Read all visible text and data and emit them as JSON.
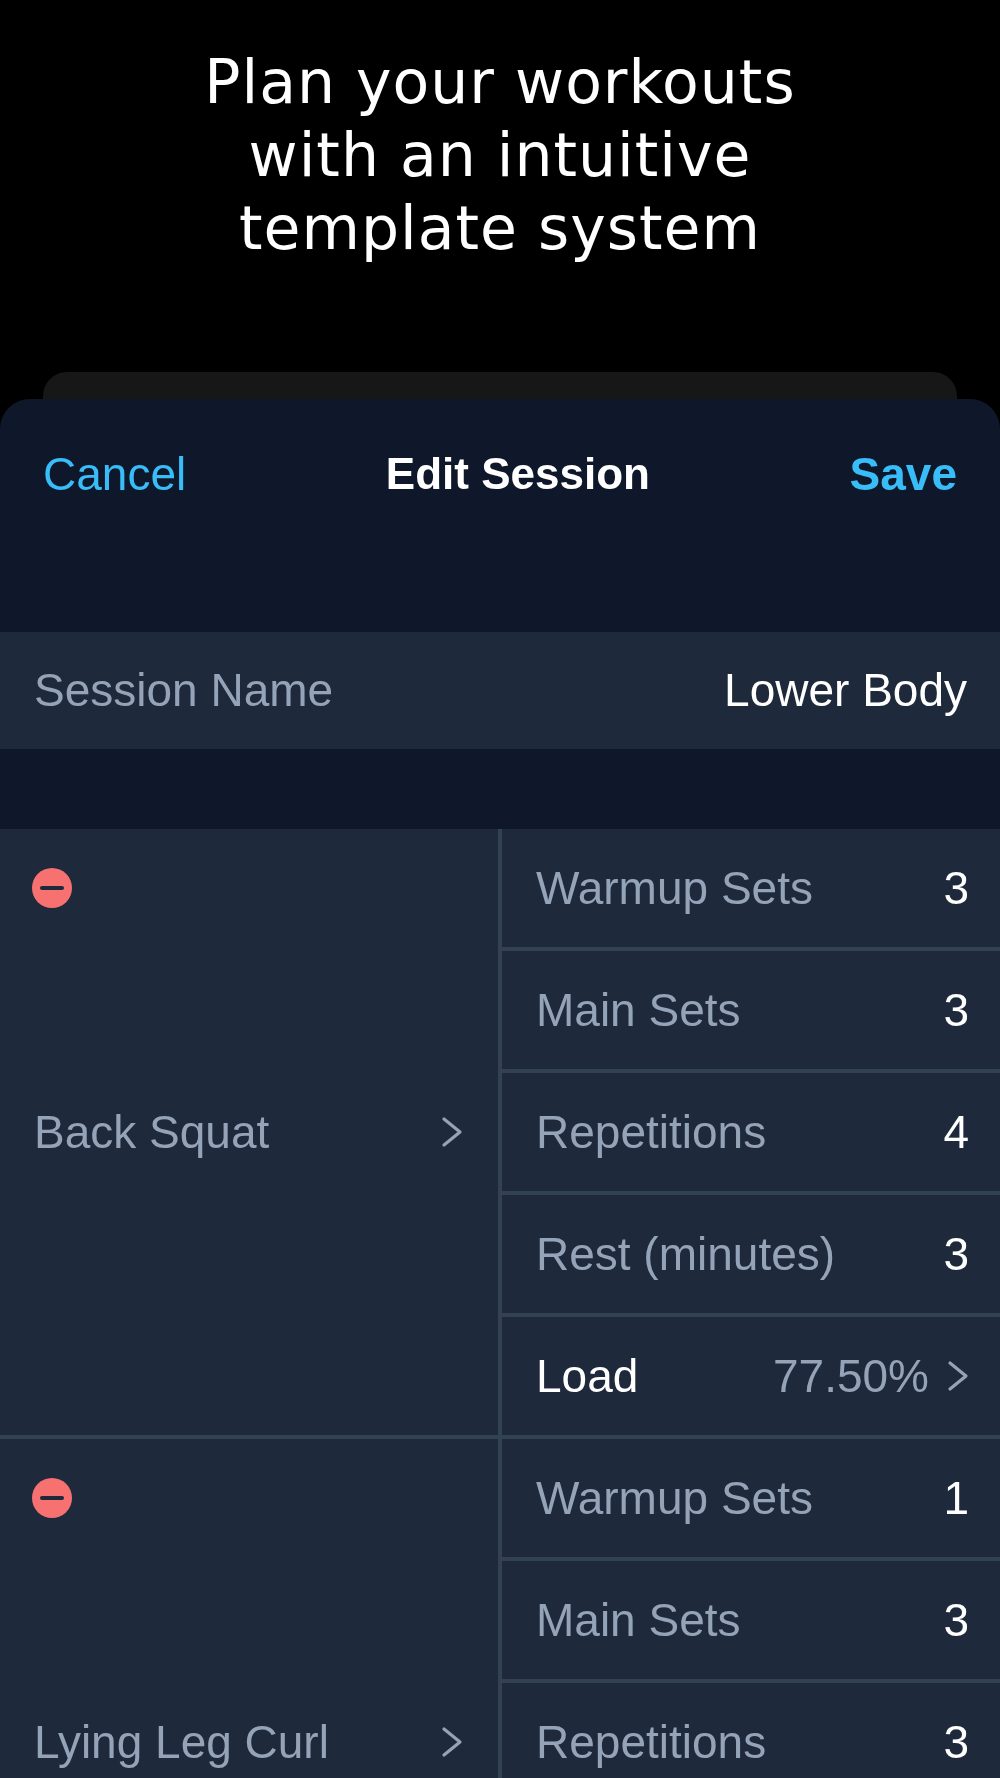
{
  "headline": "Plan your workouts\nwith an intuitive\ntemplate system",
  "sheet": {
    "cancel": "Cancel",
    "title": "Edit Session",
    "save": "Save"
  },
  "session_name": {
    "label": "Session Name",
    "value": "Lower Body"
  },
  "exercises": [
    {
      "name": "Back Squat",
      "rows": [
        {
          "kind": "number",
          "label": "Warmup Sets",
          "value": "3"
        },
        {
          "kind": "number",
          "label": "Main Sets",
          "value": "3"
        },
        {
          "kind": "number",
          "label": "Repetitions",
          "value": "4"
        },
        {
          "kind": "number",
          "label": "Rest (minutes)",
          "value": "3"
        },
        {
          "kind": "link",
          "label": "Load",
          "value": "77.50%"
        }
      ]
    },
    {
      "name": "Lying Leg Curl",
      "rows": [
        {
          "kind": "number",
          "label": "Warmup Sets",
          "value": "1"
        },
        {
          "kind": "number",
          "label": "Main Sets",
          "value": "3"
        },
        {
          "kind": "number",
          "label": "Repetitions",
          "value": "3"
        }
      ]
    }
  ]
}
